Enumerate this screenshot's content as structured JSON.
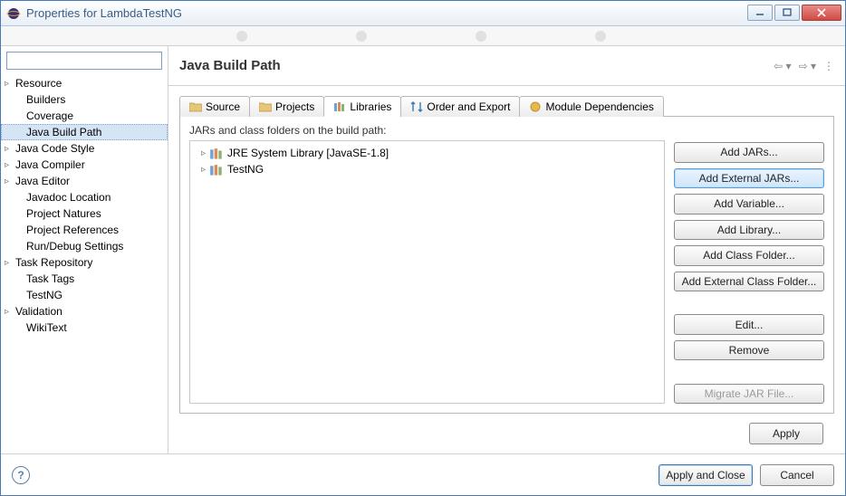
{
  "window": {
    "title": "Properties for LambdaTestNG"
  },
  "nav": {
    "search": "",
    "items": [
      {
        "label": "Resource",
        "expandable": true
      },
      {
        "label": "Builders",
        "expandable": false
      },
      {
        "label": "Coverage",
        "expandable": false
      },
      {
        "label": "Java Build Path",
        "expandable": false,
        "selected": true
      },
      {
        "label": "Java Code Style",
        "expandable": true
      },
      {
        "label": "Java Compiler",
        "expandable": true
      },
      {
        "label": "Java Editor",
        "expandable": true
      },
      {
        "label": "Javadoc Location",
        "expandable": false
      },
      {
        "label": "Project Natures",
        "expandable": false
      },
      {
        "label": "Project References",
        "expandable": false
      },
      {
        "label": "Run/Debug Settings",
        "expandable": false
      },
      {
        "label": "Task Repository",
        "expandable": true
      },
      {
        "label": "Task Tags",
        "expandable": false
      },
      {
        "label": "TestNG",
        "expandable": false
      },
      {
        "label": "Validation",
        "expandable": true
      },
      {
        "label": "WikiText",
        "expandable": false
      }
    ]
  },
  "header": {
    "title": "Java Build Path"
  },
  "tabs": [
    {
      "id": "source",
      "label": "Source",
      "icon": "folder-icon",
      "active": false
    },
    {
      "id": "projects",
      "label": "Projects",
      "icon": "folder-icon",
      "active": false
    },
    {
      "id": "libraries",
      "label": "Libraries",
      "icon": "library-icon",
      "active": true
    },
    {
      "id": "order",
      "label": "Order and Export",
      "icon": "order-icon",
      "active": false
    },
    {
      "id": "module",
      "label": "Module Dependencies",
      "icon": "module-icon",
      "active": false
    }
  ],
  "libraries": {
    "description": "JARs and class folders on the build path:",
    "items": [
      {
        "label": "JRE System Library [JavaSE-1.8]"
      },
      {
        "label": "TestNG"
      }
    ]
  },
  "sideButtons": {
    "addJars": "Add JARs...",
    "addExternalJars": "Add External JARs...",
    "addVariable": "Add Variable...",
    "addLibrary": "Add Library...",
    "addClassFolder": "Add Class Folder...",
    "addExternalClassFolder": "Add External Class Folder...",
    "edit": "Edit...",
    "remove": "Remove",
    "migrateJar": "Migrate JAR File..."
  },
  "buttons": {
    "apply": "Apply",
    "applyClose": "Apply and Close",
    "cancel": "Cancel"
  }
}
